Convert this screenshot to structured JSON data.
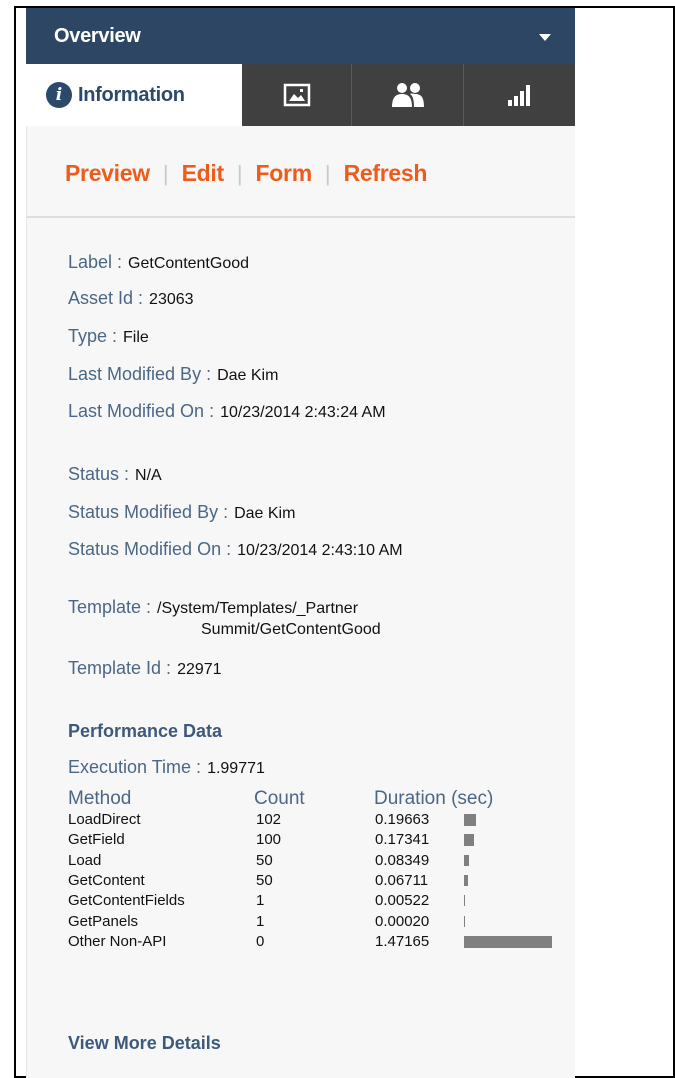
{
  "header": {
    "title": "Overview"
  },
  "tabs": [
    {
      "label": "Information",
      "icon": "info-icon",
      "active": true
    },
    {
      "icon": "image-icon"
    },
    {
      "icon": "users-icon"
    },
    {
      "icon": "bar-chart-icon"
    }
  ],
  "actions": {
    "preview": "Preview",
    "edit": "Edit",
    "form": "Form",
    "refresh": "Refresh",
    "separator": "|"
  },
  "details": {
    "label": {
      "name": "Label :",
      "value": "GetContentGood"
    },
    "asset_id": {
      "name": "Asset Id :",
      "value": "23063"
    },
    "type": {
      "name": "Type :",
      "value": "File"
    },
    "last_modified_by": {
      "name": "Last Modified By :",
      "value": "Dae Kim"
    },
    "last_modified_on": {
      "name": "Last Modified On :",
      "value": "10/23/2014 2:43:24 AM"
    },
    "status": {
      "name": "Status :",
      "value": "N/A"
    },
    "status_modified_by": {
      "name": "Status Modified By :",
      "value": "Dae Kim"
    },
    "status_modified_on": {
      "name": "Status Modified On :",
      "value": "10/23/2014 2:43:10 AM"
    },
    "template": {
      "name": "Template :",
      "value_line1": "/System/Templates/_Partner",
      "value_line2": "Summit/GetContentGood"
    },
    "template_id": {
      "name": "Template Id :",
      "value": "22971"
    }
  },
  "performance": {
    "title": "Performance Data",
    "execution_label": "Execution Time :",
    "execution_value": "1.99771",
    "columns": [
      "Method",
      "Count",
      "Duration (sec)"
    ],
    "rows": [
      {
        "method": "LoadDirect",
        "count": "102",
        "duration": "0.19663",
        "duration_num": 0.19663
      },
      {
        "method": "GetField",
        "count": "100",
        "duration": "0.17341",
        "duration_num": 0.17341
      },
      {
        "method": "Load",
        "count": "50",
        "duration": "0.08349",
        "duration_num": 0.08349
      },
      {
        "method": "GetContent",
        "count": "50",
        "duration": "0.06711",
        "duration_num": 0.06711
      },
      {
        "method": "GetContentFields",
        "count": "1",
        "duration": "0.00522",
        "duration_num": 0.00522
      },
      {
        "method": "GetPanels",
        "count": "1",
        "duration": "0.00020",
        "duration_num": 0.0002
      },
      {
        "method": "Other Non-API",
        "count": "0",
        "duration": "1.47165",
        "duration_num": 1.47165
      }
    ],
    "bar_color": "#808080"
  },
  "footer": {
    "more_link": "View More Details"
  },
  "colors": {
    "header_bg": "#2c4664",
    "tab_bar_bg": "#404040",
    "action": "#ef5b1b",
    "label": "#4b6785",
    "section": "#3d5a7a"
  }
}
